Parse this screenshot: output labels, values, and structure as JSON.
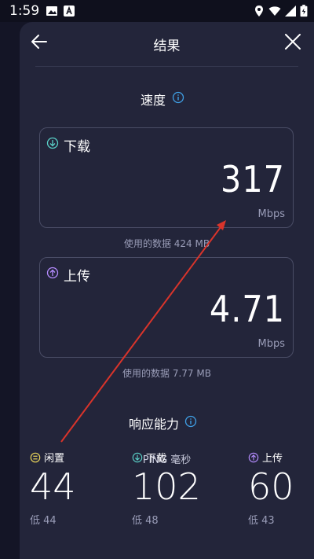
{
  "status_bar": {
    "time": "1:59"
  },
  "header": {
    "title": "结果"
  },
  "speed": {
    "section_title": "速度",
    "download": {
      "label": "下载",
      "value": "317",
      "unit": "Mbps",
      "data_used": "使用的数据 424 MB"
    },
    "upload": {
      "label": "上传",
      "value": "4.71",
      "unit": "Mbps",
      "data_used": "使用的数据 7.77 MB"
    }
  },
  "responsiveness": {
    "section_title": "响应能力",
    "ping_title": "PING 毫秒",
    "idle": {
      "label": "闲置",
      "value": "44",
      "low": "低 44"
    },
    "download": {
      "label": "下载",
      "value": "102",
      "low": "低 48"
    },
    "upload": {
      "label": "上传",
      "value": "60",
      "low": "低 43"
    }
  },
  "colors": {
    "background": "#23253a",
    "download_accent": "#5ad1c8",
    "upload_accent": "#b58cff",
    "idle_accent": "#e8d35a",
    "annotation_arrow": "#d9342b",
    "info_accent": "#3fa0e6"
  }
}
